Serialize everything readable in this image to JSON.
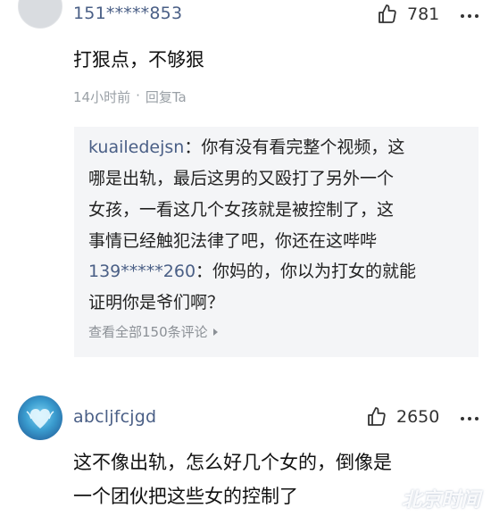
{
  "comment1": {
    "username": "151*****853",
    "likes": "781",
    "text": "打狠点，不够狠",
    "time": "14小时前",
    "separator": "·",
    "reply_action": "回复Ta",
    "replies": [
      {
        "name": "kuailedejsn",
        "colon": "：",
        "lines": [
          "你有没有看完整个视频，这",
          "哪是出轨，最后这男的又殴打了另外一个",
          "女孩，一看这几个女孩就是被控制了，这",
          "事情已经触犯法律了吧，你还在这哔哔"
        ]
      },
      {
        "name": "139*****260",
        "colon": "：",
        "lines": [
          "你妈的，你以为打女的就能",
          "证明你是爷们啊？"
        ]
      }
    ],
    "view_all": "查看全部150条评论"
  },
  "comment2": {
    "username": "abcljfcjgd",
    "likes": "2650",
    "lines": [
      "这不像出轨，怎么好几个女的，倒像是",
      "一个团伙把这些女的控制了"
    ]
  },
  "watermark": "北京时间",
  "colors": {
    "username": "#4a5f86",
    "meta": "#9aa0a6",
    "reply_bg": "#f4f5f7"
  },
  "icons": {
    "like": "thumbs-up-icon",
    "more": "more-dots-icon"
  }
}
